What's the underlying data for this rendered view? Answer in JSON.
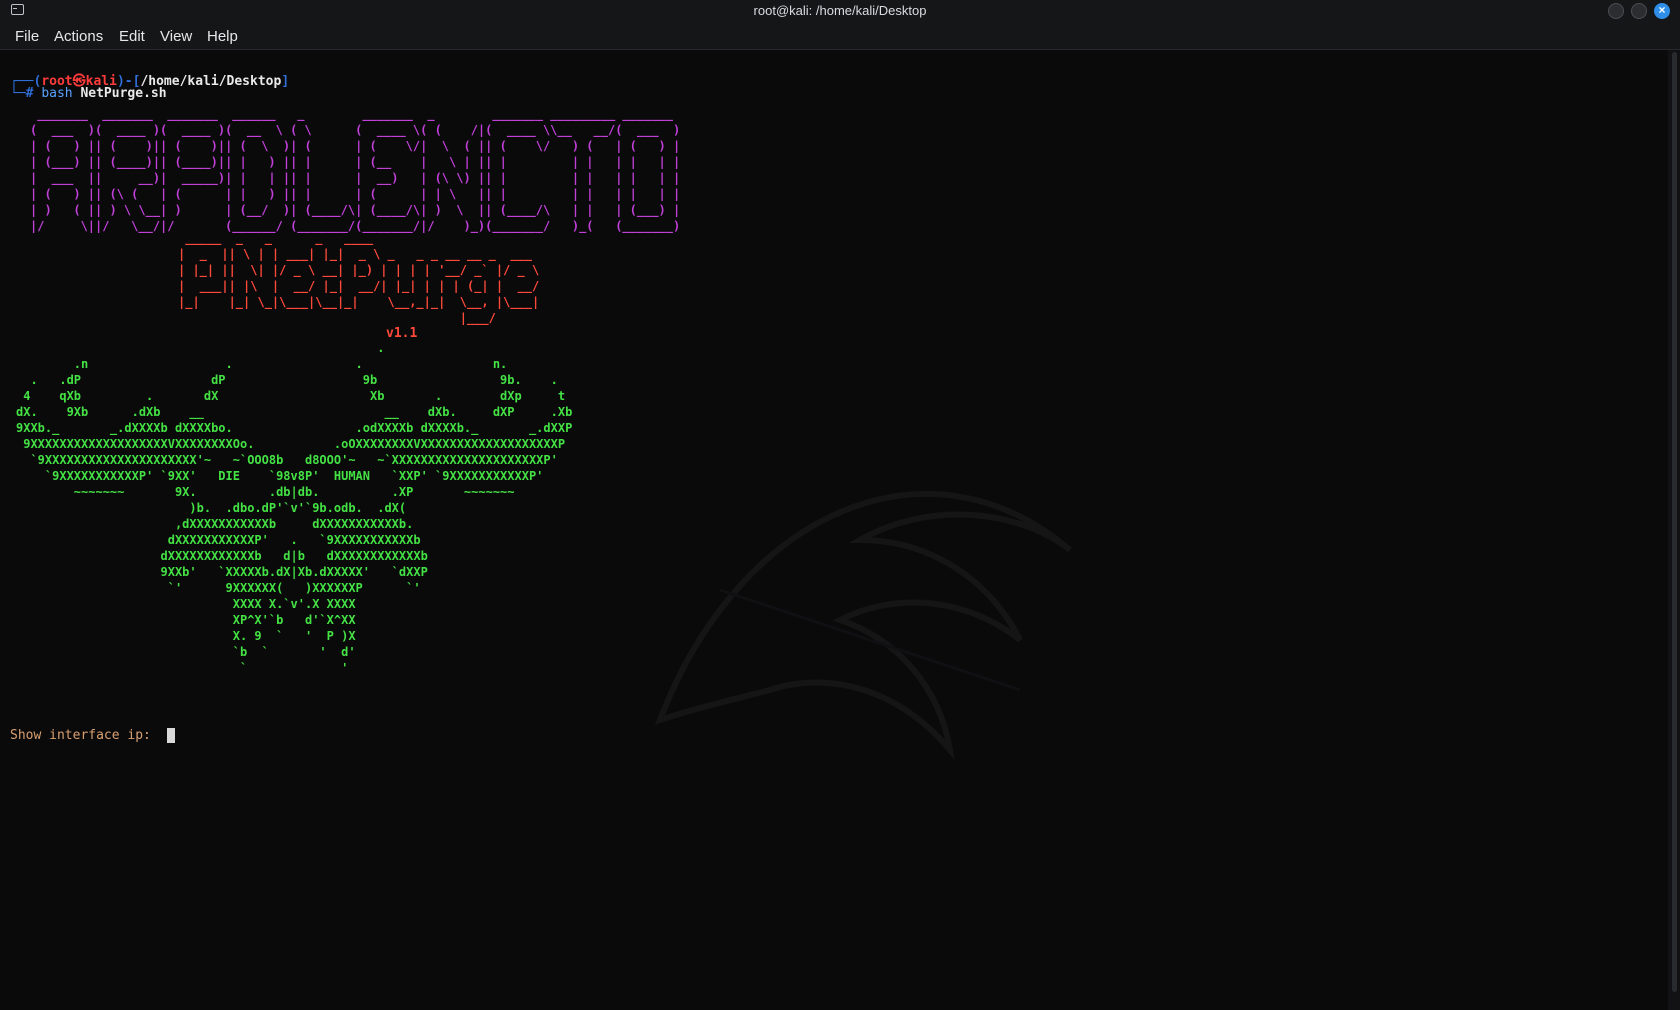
{
  "window": {
    "title": "root@kali: /home/kali/Desktop",
    "icons": [
      "terminal-icon",
      "minimize-icon",
      "maximize-icon",
      "close-icon"
    ]
  },
  "menu": {
    "items": [
      "File",
      "Actions",
      "Edit",
      "View",
      "Help"
    ]
  },
  "prompt": {
    "open": "┌──(",
    "user": "root",
    "at": "㉿",
    "host": "kali",
    "sep": ")-[",
    "path": "/home/kali/Desktop",
    "close": "]",
    "hash": "└─# ",
    "command": "bash",
    "argument": " NetPurge.sh"
  },
  "banner": {
    "art": " _______  _______  _______  ______   _        _______  _        _______ _________ _______ \n(  ___  )(  ____ )(  ____ )(  __  \\ ( \\      (  ____ \\( (    /|(  ____ \\\\__   __/(  ___  )\n| (   ) || (    )|| (    )|| (  \\  )| (      | (    \\/|  \\  ( || (    \\/   ) (   | (   ) |\n| (___) || (____)|| (____)|| |   ) || |      | (__    |   \\ | || |         | |   | |   | |\n|  ___  ||     __)|  _____)| |   | || |      |  __)   | (\\ \\) || |         | |   | |   | |\n| (   ) || (\\ (   | (      | |   ) || |      | (      | | \\   || |         | |   | |   | |\n| )   ( || ) \\ \\__| )      | (__/  )| (____/\\| (____/\\| )  \\  || (____/\\   | |   | (___) |\n|/     \\||/   \\__/|/       (______/ (_______/(_______/|/    )_)(_______/   )_(   (_______)",
    "netpurge_art": " _____  _   _      _   ____                       \n|  _  || \\ | | ___| |_|  _ \\ _   _ _ __ __ _  ___ \n| |_| ||  \\| |/ _ \\ __| |_) | | | | '__/ _` |/ _ \\\n|  ___|| |\\  |  __/ |_|  __/| |_| | | | (_| |  __/\n|_|    |_| \\_|\\___|\\__|_|    \\__,_|_|  \\__, |\\___|\n                                       |___/     ",
    "version": "v1.1",
    "skull_art": "                                                  .\n        .n                   .                 .                  n.\n  .   .dP                  dP                   9b                 9b.    .\n 4    qXb         .       dX                     Xb       .        dXp     t\ndX.    9Xb      .dXb    __                         __    dXb.     dXP     .Xb\n9XXb._       _.dXXXXb dXXXXbo.                 .odXXXXb dXXXXb._       _.dXXP\n 9XXXXXXXXXXXXXXXXXXXVXXXXXXXXOo.           .oOXXXXXXXXVXXXXXXXXXXXXXXXXXXXP\n  `9XXXXXXXXXXXXXXXXXXXXX'~   ~`OOO8b   d8OOO'~   ~`XXXXXXXXXXXXXXXXXXXXXP'\n    `9XXXXXXXXXXXP' `9XX'   DIE    `98v8P'  HUMAN   `XXP' `9XXXXXXXXXXXP'\n        ~~~~~~~       9X.          .db|db.          .XP       ~~~~~~~\n                        )b.  .dbo.dP'`v'`9b.odb.  .dX(\n                      ,dXXXXXXXXXXXb     dXXXXXXXXXXXb.\n                     dXXXXXXXXXXXP'   .   `9XXXXXXXXXXXb\n                    dXXXXXXXXXXXXb   d|b   dXXXXXXXXXXXXb\n                    9XXb'   `XXXXXb.dX|Xb.dXXXXX'   `dXXP\n                     `'      9XXXXXX(   )XXXXXXP      `'\n                              XXXX X.`v'.X XXXX\n                              XP^X'`b   d'`X^XX\n                              X. 9  `   '  P )X\n                              `b  `       '  d'\n                               `             '"
  },
  "input": {
    "label": "Show interface ip: ",
    "value": ""
  }
}
